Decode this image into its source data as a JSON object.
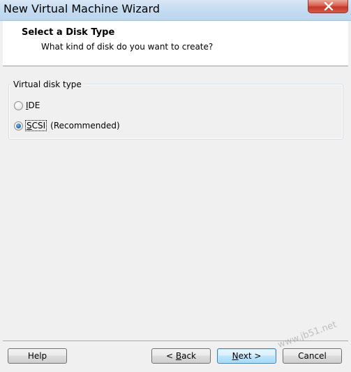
{
  "window": {
    "title": "New Virtual Machine Wizard"
  },
  "header": {
    "title": "Select a Disk Type",
    "subtitle": "What kind of disk do you want to create?"
  },
  "disk_type_group": {
    "legend": "Virtual disk type",
    "options": [
      {
        "label": "IDE",
        "mnemonic": "I",
        "rest": "DE",
        "note": "",
        "checked": false
      },
      {
        "label": "SCSI",
        "mnemonic": "S",
        "rest": "CSI",
        "note": "(Recommended)",
        "checked": true
      }
    ]
  },
  "buttons": {
    "help": "Help",
    "back_prefix": "< ",
    "back_mnemonic": "B",
    "back_rest": "ack",
    "next_mnemonic": "N",
    "next_rest": "ext >",
    "cancel": "Cancel"
  },
  "watermark": "www.jb51.net",
  "colors": {
    "titlebar": "#c6dcf1",
    "close_button": "#c4372a",
    "radio_selected": "#2a6db5",
    "default_button_border": "#3c7fb1"
  },
  "icons": {
    "close": "close-icon",
    "radio_unchecked": "radio-unchecked-icon",
    "radio_checked": "radio-checked-icon"
  }
}
